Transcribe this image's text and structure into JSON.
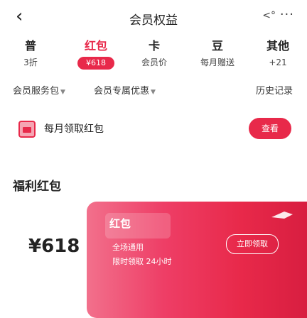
{
  "nav": {
    "back_icon": "chevron-left-icon",
    "title": "会员权益",
    "share_icon": "share-icon",
    "more_icon": "more-icon"
  },
  "tiers": [
    {
      "name": "普",
      "sub": "3折"
    },
    {
      "name": "红包",
      "sub": "¥618"
    },
    {
      "name": "卡",
      "sub": "会员价"
    },
    {
      "name": "豆",
      "sub": "每月赠送"
    },
    {
      "name": "其他",
      "sub": "+21"
    }
  ],
  "filters": {
    "left1": "会员服务包",
    "left2": "会员专属优惠",
    "right": "历史记录"
  },
  "banner": {
    "text": "每月领取红包",
    "button": "查看"
  },
  "section": {
    "title": "福利红包"
  },
  "product": {
    "price": "¥618",
    "name": "红包",
    "line1": "全场通用",
    "line2": "限时领取 24小时",
    "button": "立即领取"
  },
  "colors": {
    "accent": "#e8294a"
  }
}
